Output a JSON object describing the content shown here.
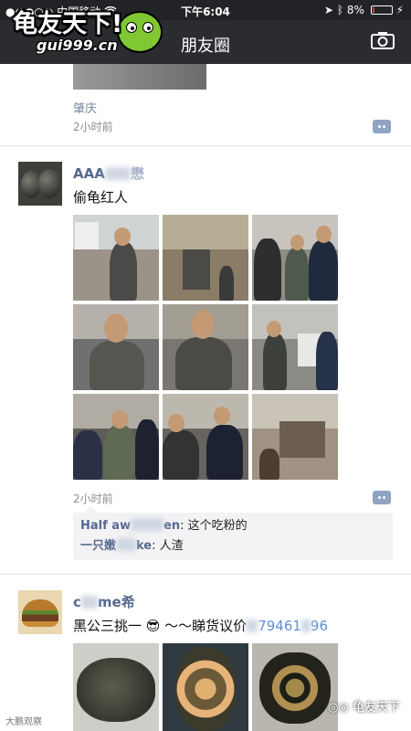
{
  "status_bar": {
    "signal": "●●●○○",
    "carrier": "中国移动",
    "time": "下午6:04",
    "battery_pct": "8%",
    "battery_level": 0.08
  },
  "nav": {
    "title": "朋友圈",
    "logo_text": "龟友天下!",
    "logo_url": "gui999.cn"
  },
  "post0": {
    "location": "肇庆",
    "time": "2小时前"
  },
  "post1": {
    "name_visible": "AAA",
    "name_tail": "懋",
    "text": "偷龟红人",
    "time": "2小时前",
    "comments": [
      {
        "name_a": "Half aw",
        "name_b": "en",
        "text": ": 这个吃粉的"
      },
      {
        "name_a": "一只嫩",
        "name_b": "ke",
        "text": ": 人渣"
      }
    ]
  },
  "post2": {
    "name_a": "c",
    "name_b": "me希",
    "text_a": "黑公三挑一 😎 ～～睇货议价",
    "text_b": "7946",
    "text_c": "1",
    "text_d": "96"
  },
  "watermarks": {
    "left": "大鹏观察",
    "right": "龟友天下"
  },
  "colors": {
    "nav_bg": "#2b2c30",
    "name_blue": "#56698f",
    "status_bg": "#222326"
  }
}
